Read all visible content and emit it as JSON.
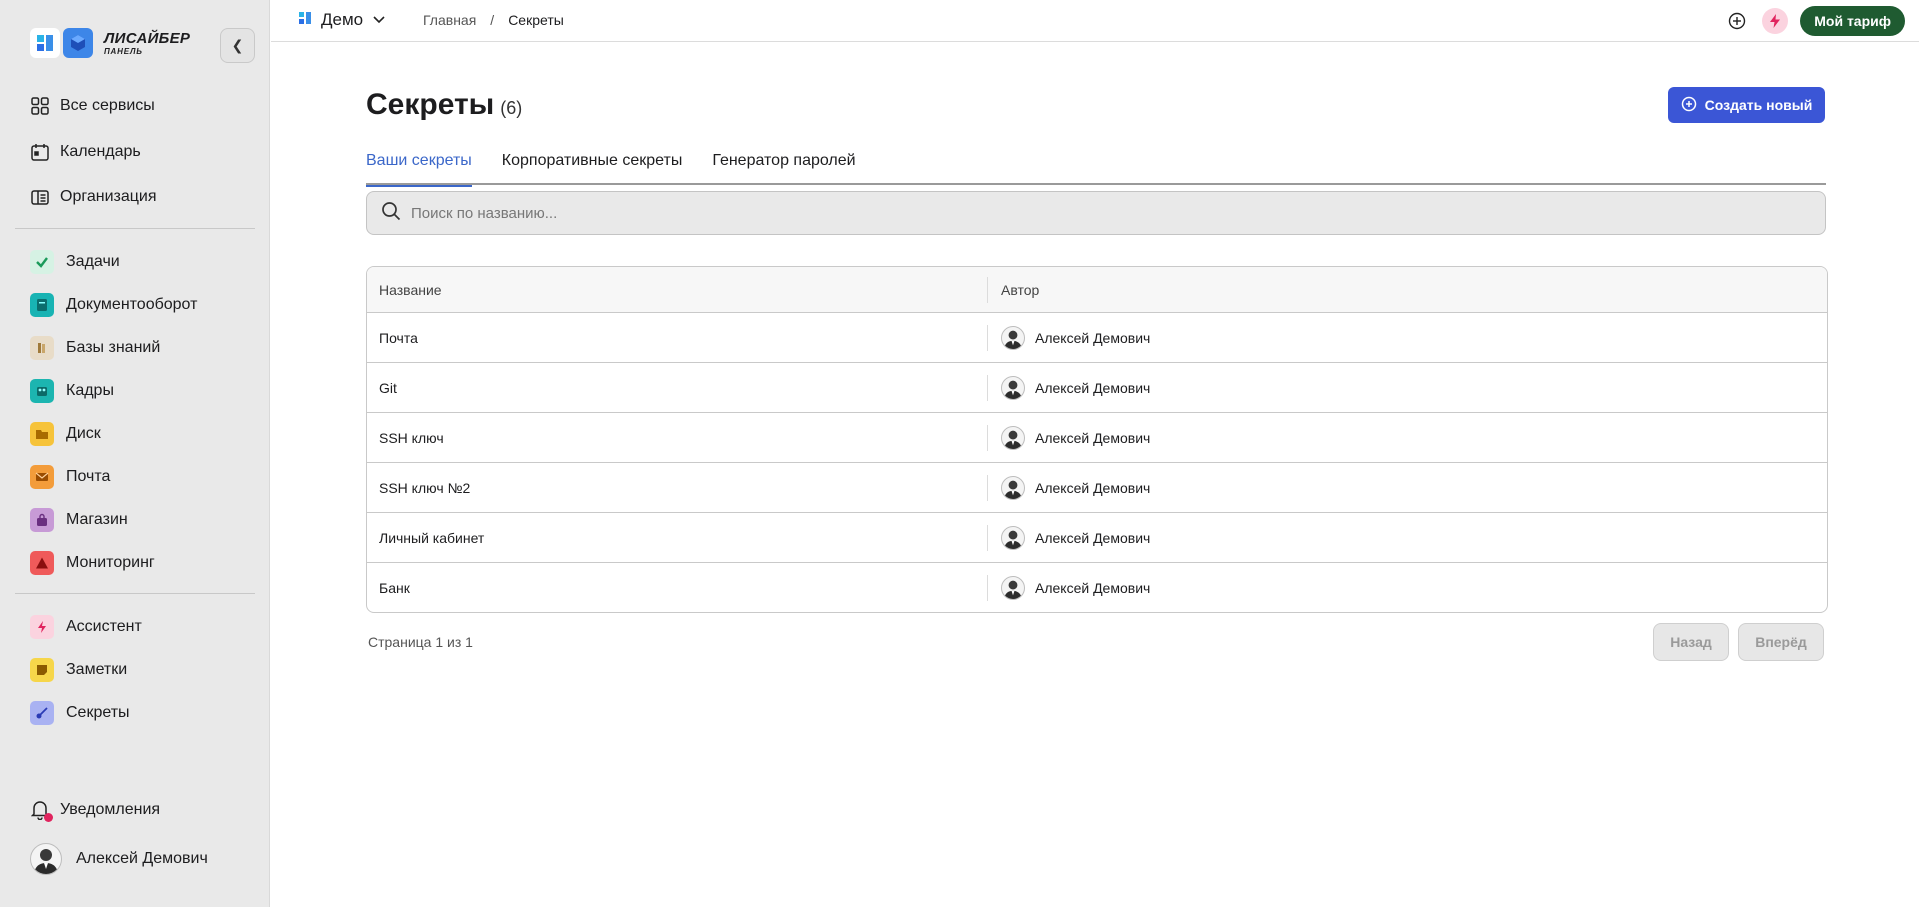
{
  "brand": {
    "name": "ЛИСАЙБЕР",
    "subtitle": "ПАНЕЛЬ"
  },
  "sidebar": {
    "top_items": [
      {
        "label": "Все сервисы",
        "icon": "grid-icon"
      },
      {
        "label": "Календарь",
        "icon": "calendar-icon"
      },
      {
        "label": "Организация",
        "icon": "organization-icon"
      }
    ],
    "apps": [
      {
        "label": "Задачи",
        "icon": "check-icon",
        "color": "#d6f2e4"
      },
      {
        "label": "Документооборот",
        "icon": "document-icon",
        "color": "#18b3b3"
      },
      {
        "label": "Базы знаний",
        "icon": "book-icon",
        "color": "#e8dcc8"
      },
      {
        "label": "Кадры",
        "icon": "people-icon",
        "color": "#1cb5b0"
      },
      {
        "label": "Диск",
        "icon": "folder-icon",
        "color": "#f6c33a"
      },
      {
        "label": "Почта",
        "icon": "mail-icon",
        "color": "#f39c3a"
      },
      {
        "label": "Магазин",
        "icon": "bag-icon",
        "color": "#c79ad6"
      },
      {
        "label": "Мониторинг",
        "icon": "warning-icon",
        "color": "#ef5a5a"
      }
    ],
    "extras": [
      {
        "label": "Ассистент",
        "icon": "lightning-icon",
        "color": "#fbd3df"
      },
      {
        "label": "Заметки",
        "icon": "note-icon",
        "color": "#f6d64a"
      },
      {
        "label": "Секреты",
        "icon": "key-icon",
        "color": "#a9b2f2"
      }
    ],
    "notifications_label": "Уведомления",
    "user_name": "Алексей Демович"
  },
  "topbar": {
    "project": "Демо",
    "breadcrumb": {
      "home": "Главная",
      "separator": "/",
      "current": "Секреты"
    },
    "plan_label": "Мой тариф"
  },
  "page": {
    "title": "Секреты",
    "count": "(6)",
    "create_label": "Создать новый",
    "tabs": [
      {
        "label": "Ваши секреты",
        "active": true
      },
      {
        "label": "Корпоративные секреты",
        "active": false
      },
      {
        "label": "Генератор паролей",
        "active": false
      }
    ],
    "search_placeholder": "Поиск по названию..."
  },
  "table": {
    "columns": [
      "Название",
      "Автор"
    ],
    "rows": [
      {
        "name": "Почта",
        "author": "Алексей Демович"
      },
      {
        "name": "Git",
        "author": "Алексей Демович"
      },
      {
        "name": "SSH ключ",
        "author": "Алексей Демович"
      },
      {
        "name": "SSH ключ №2",
        "author": "Алексей Демович"
      },
      {
        "name": "Личный кабинет",
        "author": "Алексей Демович"
      },
      {
        "name": "Банк",
        "author": "Алексей Демович"
      }
    ]
  },
  "pagination": {
    "info": "Страница 1 из 1",
    "prev_label": "Назад",
    "next_label": "Вперёд"
  },
  "colors": {
    "primary": "#3b56d6",
    "tab_active": "#3b67c9",
    "plan": "#1f5b31"
  }
}
